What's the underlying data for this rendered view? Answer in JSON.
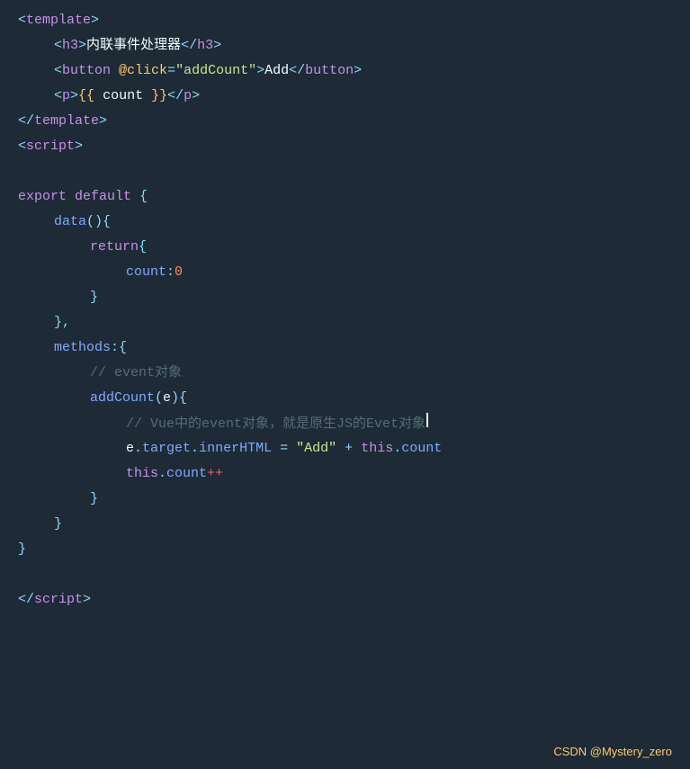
{
  "code": {
    "lines": [
      {
        "id": 1,
        "indent": 0,
        "tokens": [
          {
            "class": "c-angle",
            "text": "<"
          },
          {
            "class": "c-tag",
            "text": "template"
          },
          {
            "class": "c-angle",
            "text": ">"
          }
        ]
      },
      {
        "id": 2,
        "indent": 1,
        "tokens": [
          {
            "class": "c-angle",
            "text": "<"
          },
          {
            "class": "c-tag",
            "text": "h3"
          },
          {
            "class": "c-angle",
            "text": ">"
          },
          {
            "class": "c-text",
            "text": "内联事件处理器"
          },
          {
            "class": "c-angle",
            "text": "</"
          },
          {
            "class": "c-tag",
            "text": "h3"
          },
          {
            "class": "c-angle",
            "text": ">"
          }
        ]
      },
      {
        "id": 3,
        "indent": 1,
        "tokens": [
          {
            "class": "c-angle",
            "text": "<"
          },
          {
            "class": "c-tag",
            "text": "button"
          },
          {
            "class": "c-text",
            "text": " "
          },
          {
            "class": "c-attr",
            "text": "@click"
          },
          {
            "class": "c-equals",
            "text": "="
          },
          {
            "class": "c-string",
            "text": "\"addCount\""
          },
          {
            "class": "c-angle",
            "text": ">"
          },
          {
            "class": "c-text",
            "text": "Add"
          },
          {
            "class": "c-angle",
            "text": "</"
          },
          {
            "class": "c-tag",
            "text": "button"
          },
          {
            "class": "c-angle",
            "text": ">"
          }
        ]
      },
      {
        "id": 4,
        "indent": 1,
        "tokens": [
          {
            "class": "c-angle",
            "text": "<"
          },
          {
            "class": "c-tag",
            "text": "p"
          },
          {
            "class": "c-angle",
            "text": ">"
          },
          {
            "class": "c-brace-yellow",
            "text": "{{ "
          },
          {
            "class": "c-template-var",
            "text": "count"
          },
          {
            "class": "c-brace-yellow",
            "text": " }}"
          },
          {
            "class": "c-angle",
            "text": "</"
          },
          {
            "class": "c-tag",
            "text": "p"
          },
          {
            "class": "c-angle",
            "text": ">"
          }
        ]
      },
      {
        "id": 5,
        "indent": 0,
        "tokens": [
          {
            "class": "c-angle",
            "text": "</"
          },
          {
            "class": "c-tag",
            "text": "template"
          },
          {
            "class": "c-angle",
            "text": ">"
          }
        ]
      },
      {
        "id": 6,
        "indent": 0,
        "tokens": [
          {
            "class": "c-angle",
            "text": "<"
          },
          {
            "class": "c-tag",
            "text": "script"
          },
          {
            "class": "c-angle",
            "text": ">"
          }
        ]
      },
      {
        "id": 7,
        "indent": 0,
        "tokens": []
      },
      {
        "id": 8,
        "indent": 0,
        "tokens": [
          {
            "class": "c-keyword",
            "text": "export"
          },
          {
            "class": "c-text",
            "text": " "
          },
          {
            "class": "c-keyword",
            "text": "default"
          },
          {
            "class": "c-text",
            "text": " "
          },
          {
            "class": "c-punct",
            "text": "{"
          }
        ]
      },
      {
        "id": 9,
        "indent": 1,
        "tokens": [
          {
            "class": "c-fn",
            "text": "data"
          },
          {
            "class": "c-punct",
            "text": "()"
          },
          {
            "class": "c-punct",
            "text": "{"
          }
        ]
      },
      {
        "id": 10,
        "indent": 2,
        "tokens": [
          {
            "class": "c-keyword",
            "text": "return"
          },
          {
            "class": "c-punct",
            "text": "{"
          }
        ]
      },
      {
        "id": 11,
        "indent": 3,
        "tokens": [
          {
            "class": "c-property",
            "text": "count"
          },
          {
            "class": "c-punct",
            "text": ":"
          },
          {
            "class": "c-number",
            "text": "0"
          }
        ]
      },
      {
        "id": 12,
        "indent": 2,
        "tokens": [
          {
            "class": "c-punct",
            "text": "}"
          }
        ]
      },
      {
        "id": 13,
        "indent": 1,
        "tokens": [
          {
            "class": "c-punct",
            "text": "},"
          }
        ]
      },
      {
        "id": 14,
        "indent": 1,
        "tokens": [
          {
            "class": "c-property",
            "text": "methods"
          },
          {
            "class": "c-punct",
            "text": ":{"
          }
        ]
      },
      {
        "id": 15,
        "indent": 2,
        "tokens": [
          {
            "class": "c-comment",
            "text": "// event对象"
          }
        ]
      },
      {
        "id": 16,
        "indent": 2,
        "tokens": [
          {
            "class": "c-fn",
            "text": "addCount"
          },
          {
            "class": "c-punct",
            "text": "("
          },
          {
            "class": "c-variable",
            "text": "e"
          },
          {
            "class": "c-punct",
            "text": "){"
          }
        ]
      },
      {
        "id": 17,
        "indent": 3,
        "tokens": [
          {
            "class": "c-comment",
            "text": "// Vue中的event对象，就是原生JS的Evet对象"
          }
        ]
      },
      {
        "id": 18,
        "indent": 3,
        "tokens": [
          {
            "class": "c-variable",
            "text": "e"
          },
          {
            "class": "c-punct",
            "text": "."
          },
          {
            "class": "c-property",
            "text": "target"
          },
          {
            "class": "c-punct",
            "text": "."
          },
          {
            "class": "c-property",
            "text": "innerHTML"
          },
          {
            "class": "c-text",
            "text": " "
          },
          {
            "class": "c-equals",
            "text": "="
          },
          {
            "class": "c-text",
            "text": " "
          },
          {
            "class": "c-string",
            "text": "\"Add\""
          },
          {
            "class": "c-text",
            "text": " "
          },
          {
            "class": "c-punct",
            "text": "+"
          },
          {
            "class": "c-text",
            "text": " "
          },
          {
            "class": "c-this",
            "text": "this"
          },
          {
            "class": "c-punct",
            "text": "."
          },
          {
            "class": "c-property",
            "text": "count"
          }
        ]
      },
      {
        "id": 19,
        "indent": 3,
        "tokens": [
          {
            "class": "c-this",
            "text": "this"
          },
          {
            "class": "c-punct",
            "text": "."
          },
          {
            "class": "c-property",
            "text": "count"
          },
          {
            "class": "c-special",
            "text": "++"
          }
        ]
      },
      {
        "id": 20,
        "indent": 2,
        "tokens": [
          {
            "class": "c-punct",
            "text": "}"
          }
        ]
      },
      {
        "id": 21,
        "indent": 1,
        "tokens": [
          {
            "class": "c-punct",
            "text": "}"
          }
        ]
      },
      {
        "id": 22,
        "indent": 0,
        "tokens": [
          {
            "class": "c-punct",
            "text": "}"
          }
        ]
      },
      {
        "id": 23,
        "indent": 0,
        "tokens": []
      },
      {
        "id": 24,
        "indent": 0,
        "tokens": [
          {
            "class": "c-angle",
            "text": "</"
          },
          {
            "class": "c-tag",
            "text": "script"
          },
          {
            "class": "c-angle",
            "text": ">"
          }
        ]
      }
    ]
  },
  "watermark": {
    "text": "CSDN @Mystery_zero"
  }
}
